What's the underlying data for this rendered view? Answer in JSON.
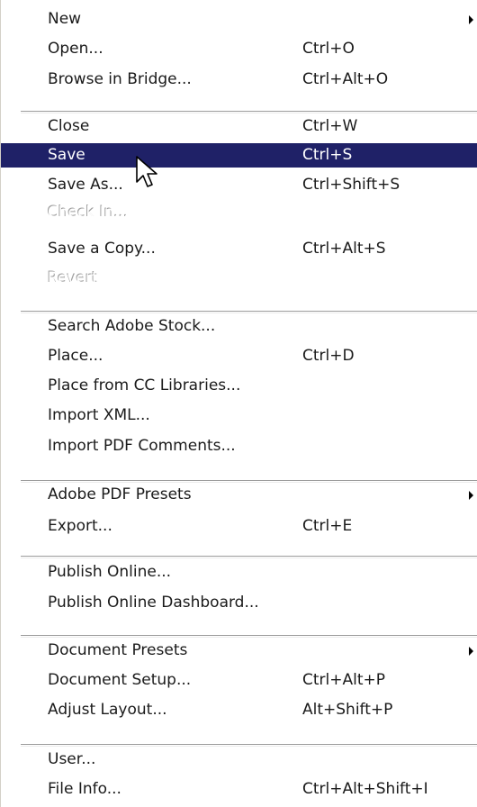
{
  "menu": {
    "groups": [
      {
        "items": [
          {
            "label": "New",
            "shortcut": "",
            "submenu": true,
            "disabled": false,
            "highlighted": false,
            "icon": "submenu-arrow-icon"
          },
          {
            "label": "Open...",
            "shortcut": "Ctrl+O",
            "submenu": false,
            "disabled": false,
            "highlighted": false
          },
          {
            "label": "Browse in Bridge...",
            "shortcut": "Ctrl+Alt+O",
            "submenu": false,
            "disabled": false,
            "highlighted": false
          }
        ]
      },
      {
        "items": [
          {
            "label": "Close",
            "shortcut": "Ctrl+W",
            "submenu": false,
            "disabled": false,
            "highlighted": false
          },
          {
            "label": "Save",
            "shortcut": "Ctrl+S",
            "submenu": false,
            "disabled": false,
            "highlighted": true
          },
          {
            "label": "Save As...",
            "shortcut": "Ctrl+Shift+S",
            "submenu": false,
            "disabled": false,
            "highlighted": false
          },
          {
            "label": "Check In...",
            "shortcut": "",
            "submenu": false,
            "disabled": true,
            "highlighted": false
          },
          {
            "label": "Save a Copy...",
            "shortcut": "Ctrl+Alt+S",
            "submenu": false,
            "disabled": false,
            "highlighted": false
          },
          {
            "label": "Revert",
            "shortcut": "",
            "submenu": false,
            "disabled": true,
            "highlighted": false
          }
        ]
      },
      {
        "items": [
          {
            "label": "Search Adobe Stock...",
            "shortcut": "",
            "submenu": false,
            "disabled": false,
            "highlighted": false
          },
          {
            "label": "Place...",
            "shortcut": "Ctrl+D",
            "submenu": false,
            "disabled": false,
            "highlighted": false
          },
          {
            "label": "Place from CC Libraries...",
            "shortcut": "",
            "submenu": false,
            "disabled": false,
            "highlighted": false
          },
          {
            "label": "Import XML...",
            "shortcut": "",
            "submenu": false,
            "disabled": false,
            "highlighted": false
          },
          {
            "label": "Import PDF Comments...",
            "shortcut": "",
            "submenu": false,
            "disabled": false,
            "highlighted": false
          }
        ]
      },
      {
        "items": [
          {
            "label": "Adobe PDF Presets",
            "shortcut": "",
            "submenu": true,
            "disabled": false,
            "highlighted": false
          },
          {
            "label": "Export...",
            "shortcut": "Ctrl+E",
            "submenu": false,
            "disabled": false,
            "highlighted": false
          }
        ]
      },
      {
        "items": [
          {
            "label": "Publish Online...",
            "shortcut": "",
            "submenu": false,
            "disabled": false,
            "highlighted": false
          },
          {
            "label": "Publish Online Dashboard...",
            "shortcut": "",
            "submenu": false,
            "disabled": false,
            "highlighted": false
          }
        ]
      },
      {
        "items": [
          {
            "label": "Document Presets",
            "shortcut": "",
            "submenu": true,
            "disabled": false,
            "highlighted": false
          },
          {
            "label": "Document Setup...",
            "shortcut": "Ctrl+Alt+P",
            "submenu": false,
            "disabled": false,
            "highlighted": false
          },
          {
            "label": "Adjust Layout...",
            "shortcut": "Alt+Shift+P",
            "submenu": false,
            "disabled": false,
            "highlighted": false
          }
        ]
      },
      {
        "items": [
          {
            "label": "User...",
            "shortcut": "",
            "submenu": false,
            "disabled": false,
            "highlighted": false
          },
          {
            "label": "File Info...",
            "shortcut": "Ctrl+Alt+Shift+I",
            "submenu": false,
            "disabled": false,
            "highlighted": false
          }
        ]
      }
    ],
    "colors": {
      "highlight_background": "#1f2167",
      "highlight_text": "#ffffff",
      "text": "#1a1a1a",
      "disabled_text": "#a0a0a0",
      "background": "#ffffff"
    },
    "cursor": {
      "icon": "mouse-pointer-icon"
    }
  }
}
